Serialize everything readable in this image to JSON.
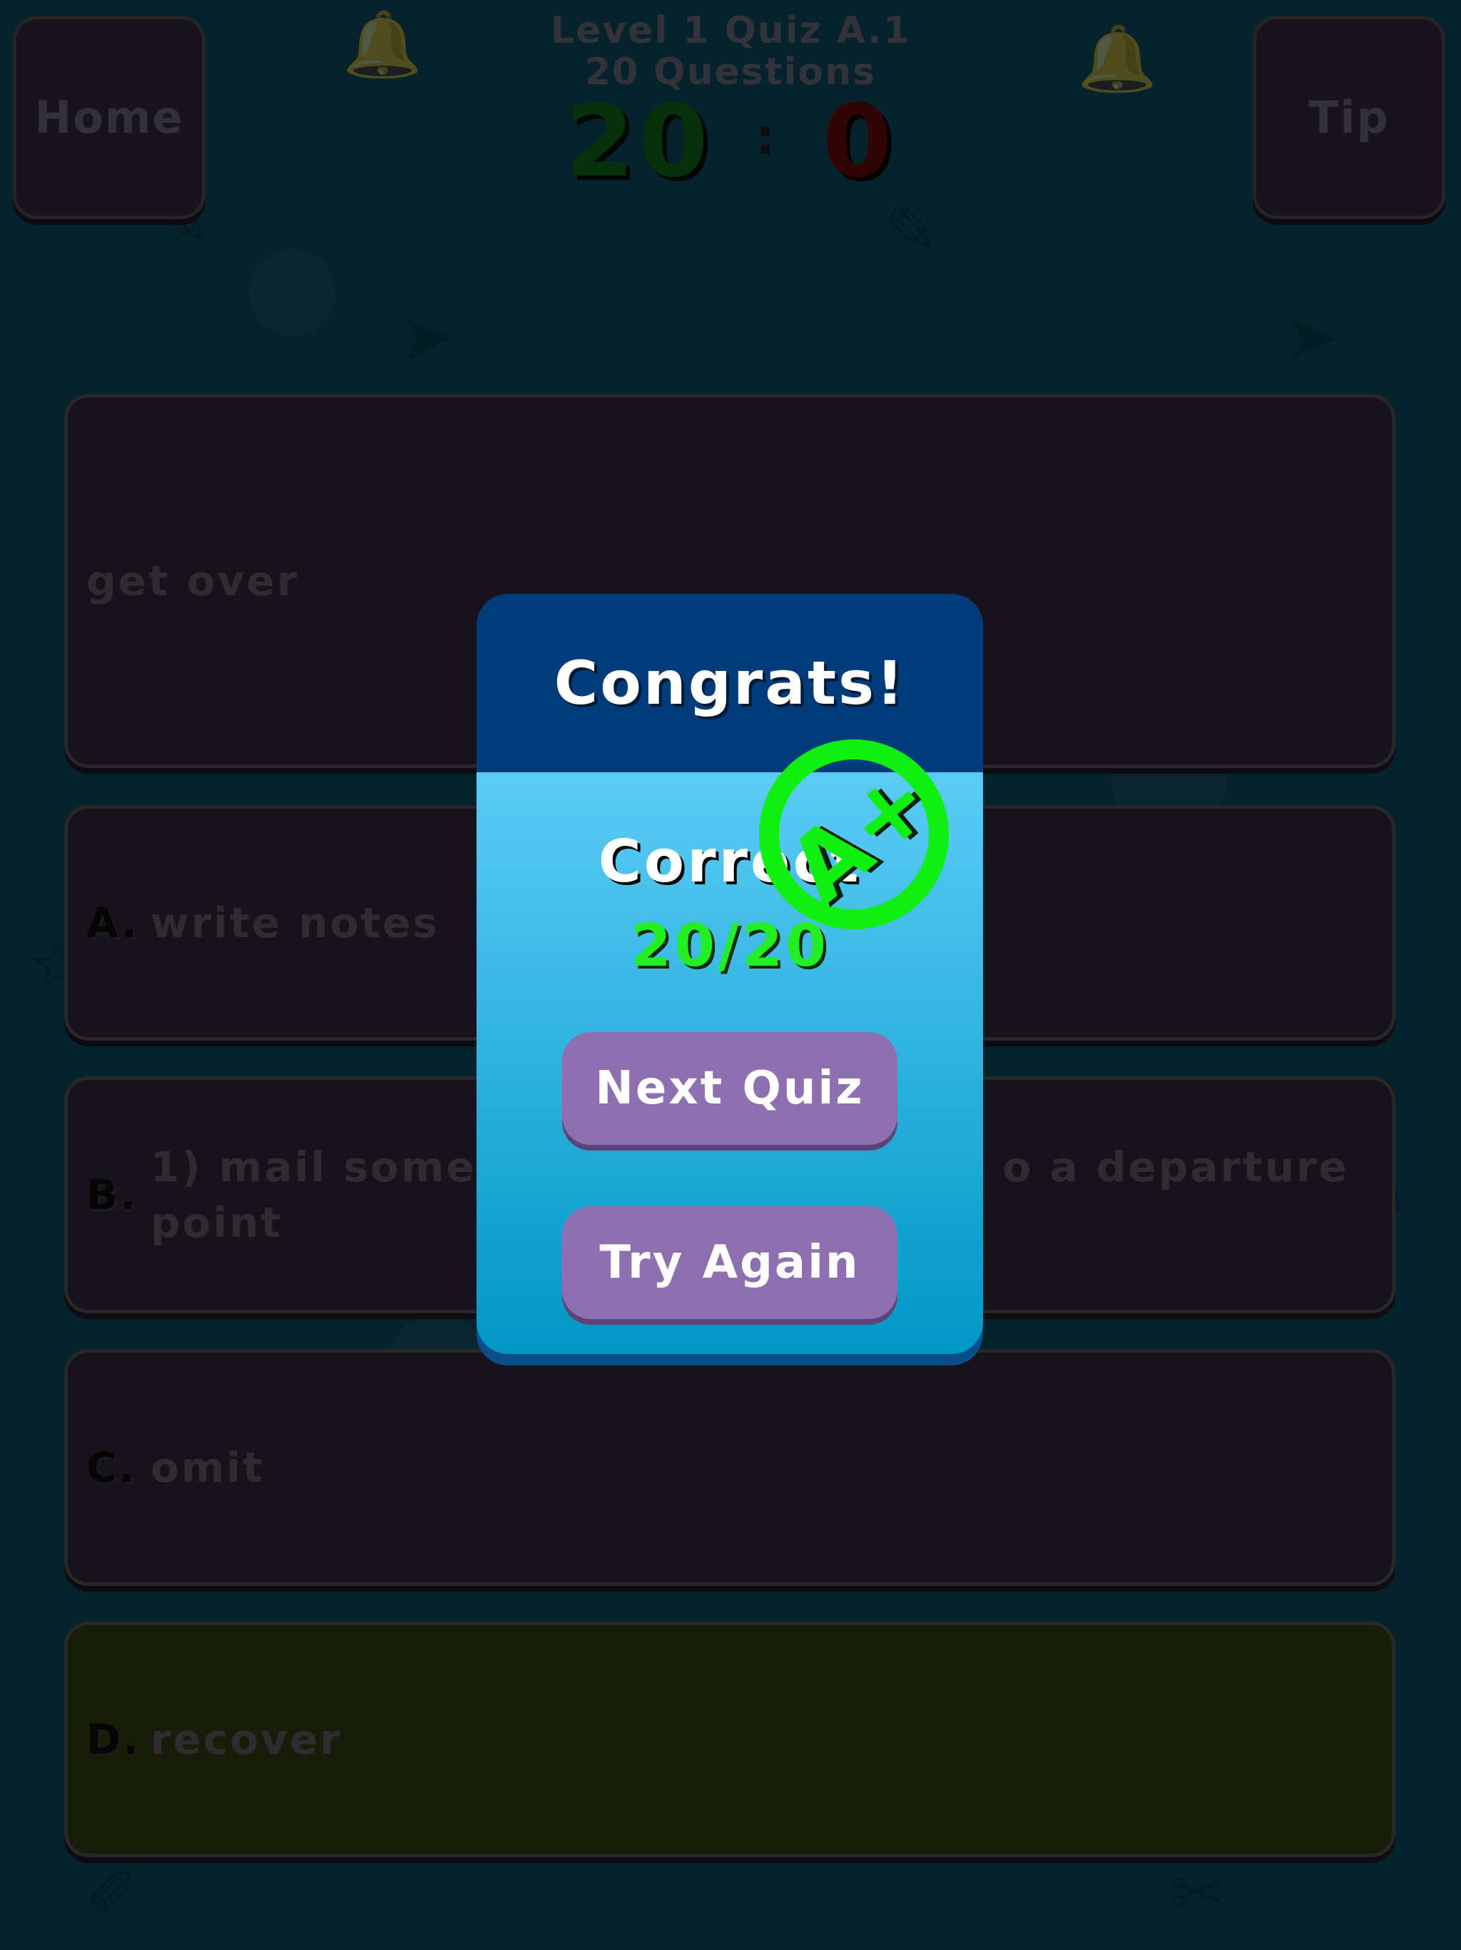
{
  "header": {
    "title_line1": "Level 1 Quiz A.1",
    "title_line2": "20 Questions",
    "score_correct": "20",
    "score_separator": ":",
    "score_wrong": "0",
    "home_label": "Home",
    "tip_label": "Tip"
  },
  "question": {
    "text": "get over"
  },
  "options": [
    {
      "letter": "A.",
      "text": "write notes"
    },
    {
      "letter": "B.",
      "text_line1": "1) mail someth",
      "text_line1b": "o a departure",
      "text_line2": "point"
    },
    {
      "letter": "C.",
      "text": "omit"
    },
    {
      "letter": "D.",
      "text": "recover"
    }
  ],
  "modal": {
    "title": "Congrats!",
    "correct_label": "Correct",
    "correct_value": "20/20",
    "grade": "A+",
    "next_label": "Next Quiz",
    "again_label": "Try Again"
  },
  "colors": {
    "background": "#0c3f50",
    "card": "#2b2234",
    "selected_card": "#2c3512",
    "modal_header": "#003c7a",
    "modal_body_top": "#5bccf6",
    "modal_body_bottom": "#0097c6",
    "button": "#8e6fb0",
    "grade_green": "#11ee11"
  }
}
